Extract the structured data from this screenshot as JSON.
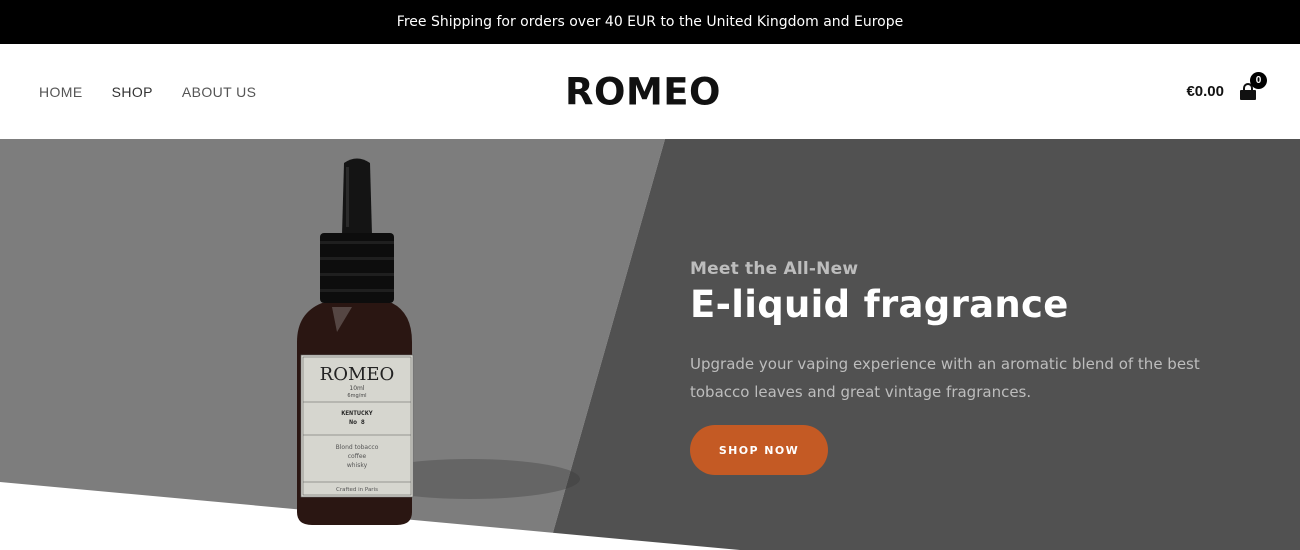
{
  "announcement": "Free Shipping for orders over 40 EUR to the United Kingdom and Europe",
  "nav": {
    "home": "HOME",
    "shop": "SHOP",
    "about": "ABOUT US"
  },
  "brand": "ROMEO",
  "cart": {
    "total": "€0.00",
    "count": "0"
  },
  "hero": {
    "eyebrow": "Meet the All-New",
    "headline": "E-liquid fragrance",
    "description": "Upgrade your vaping experience with an aromatic blend of the best tobacco leaves and great vintage fragrances.",
    "cta": "SHOP NOW"
  },
  "product_label": {
    "brand": "ROMEO",
    "volume": "10ml",
    "strength": "6mg/ml",
    "name_line1": "KENTUCKY",
    "name_line2": "No 8",
    "notes": [
      "Blond tobacco",
      "coffee",
      "whisky"
    ],
    "footer": "Crafted in Paris"
  },
  "colors": {
    "cta": "#c45a24",
    "hero_dark": "#515151",
    "hero_light": "#7d7d7d",
    "topbar": "#000000"
  }
}
